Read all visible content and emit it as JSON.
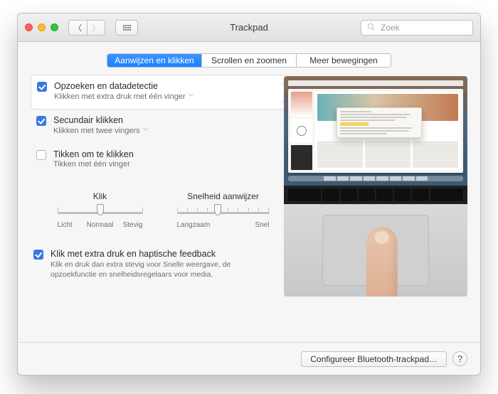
{
  "window": {
    "title": "Trackpad"
  },
  "toolbar": {
    "back_icon": "chevron-left-icon",
    "forward_icon": "chevron-right-icon",
    "apps_icon": "grid-icon"
  },
  "search": {
    "placeholder": "Zoek",
    "value": ""
  },
  "tabs": [
    {
      "label": "Aanwijzen en klikken",
      "active": true
    },
    {
      "label": "Scrollen en zoomen",
      "active": false
    },
    {
      "label": "Meer bewegingen",
      "active": false
    }
  ],
  "options": [
    {
      "id": "lookup",
      "checked": true,
      "title": "Opzoeken en datadetectie",
      "subtitle": "Klikken met extra druk met één vinger",
      "has_menu": true,
      "selected": true
    },
    {
      "id": "secondary",
      "checked": true,
      "title": "Secundair klikken",
      "subtitle": "Klikken met twee vingers",
      "has_menu": true,
      "selected": false
    },
    {
      "id": "tap",
      "checked": false,
      "title": "Tikken om te klikken",
      "subtitle": "Tikken met één vinger",
      "has_menu": false,
      "selected": false
    }
  ],
  "sliders": {
    "click": {
      "caption": "Klik",
      "labels": [
        "Licht",
        "Normaal",
        "Stevig"
      ],
      "stops": 3,
      "index": 1
    },
    "tracking": {
      "caption": "Snelheid aanwijzer",
      "labels": [
        "Langzaam",
        "Snel"
      ],
      "stops": 10,
      "index": 4
    }
  },
  "force_click": {
    "checked": true,
    "title": "Klik met extra druk en haptische feedback",
    "subtitle": "Klik en druk dan extra stevig voor Snelle weergave, de opzoekfunctie en snelheidsregelaars voor media."
  },
  "footer": {
    "bluetooth_label": "Configureer Bluetooth-trackpad…",
    "help_label": "?"
  },
  "colors": {
    "accent": "#1a82ff",
    "checkbox": "#3978de"
  }
}
